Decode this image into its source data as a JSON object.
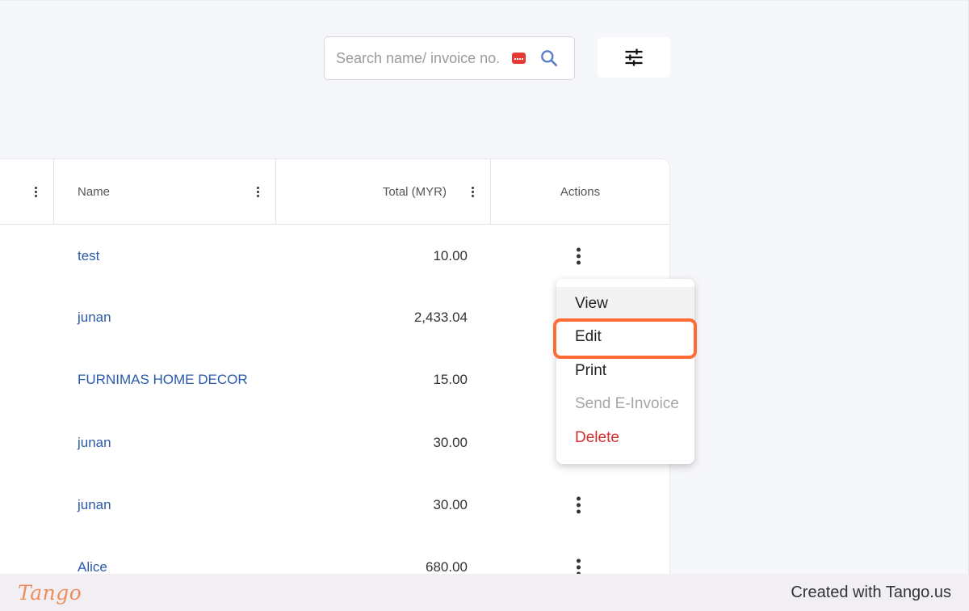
{
  "search": {
    "placeholder": "Search name/ invoice no."
  },
  "icons": {
    "search": "search-icon",
    "filter": "sliders-icon",
    "column_menu": "more-vertical-icon",
    "row_actions": "more-vertical-icon"
  },
  "table": {
    "headers": {
      "name": "Name",
      "total": "Total (MYR)",
      "actions": "Actions"
    },
    "rows": [
      {
        "name": "test",
        "total": "10.00"
      },
      {
        "name": "junan",
        "total": "2,433.04"
      },
      {
        "name": "FURNIMAS HOME DECOR",
        "total": "15.00"
      },
      {
        "name": "junan",
        "total": "30.00"
      },
      {
        "name": "junan",
        "total": "30.00"
      },
      {
        "name": "Alice",
        "total": "680.00"
      }
    ]
  },
  "menu": {
    "items": [
      "View",
      "Edit",
      "Print",
      "Send E-Invoice",
      "Delete"
    ]
  },
  "colors": {
    "link": "#2a5aa8",
    "highlight": "#ff6b35",
    "danger": "#d32f2f",
    "disabled": "#a6a6a6"
  },
  "footer": {
    "logo": "Tango",
    "credit": "Created with Tango.us"
  }
}
